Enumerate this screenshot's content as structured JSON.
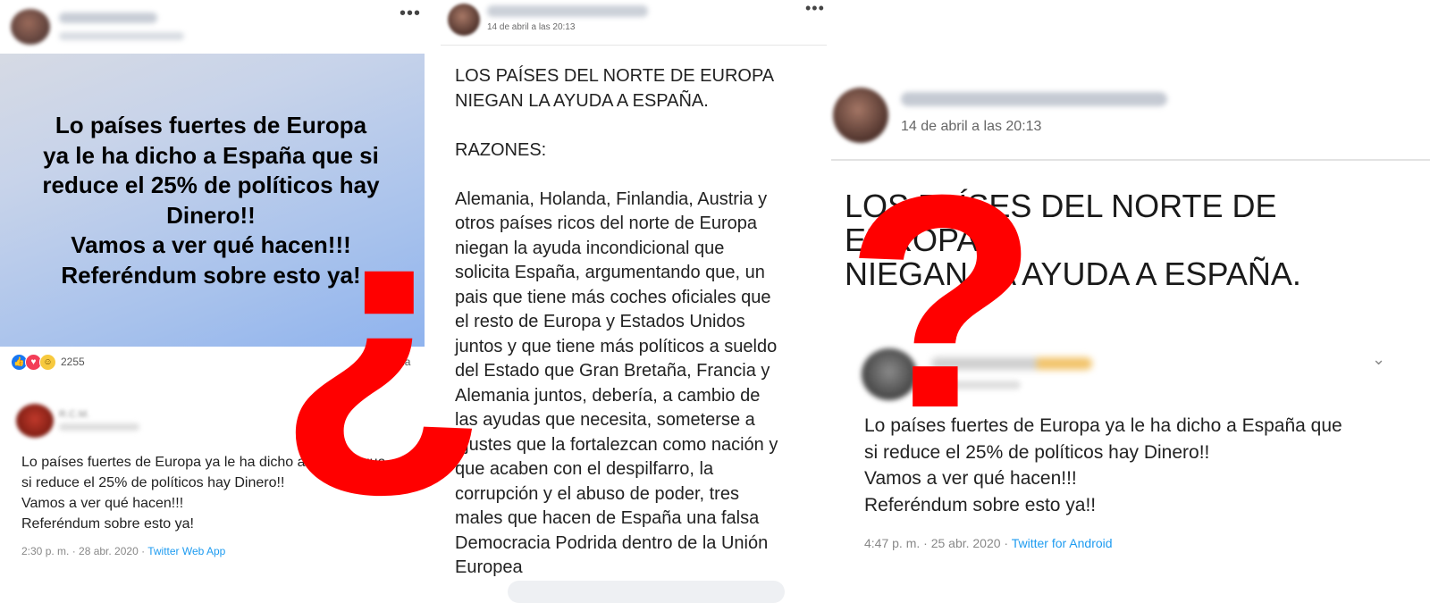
{
  "panel_a": {
    "card_text": "Lo países fuertes de Europa\nya le ha dicho a España que si\nreduce el 25% de políticos hay\nDinero!!\nVamos a ver qué hacen!!!\nReferéndum sobre esto ya!",
    "reaction_count": "2255",
    "shared_label": "compartida",
    "tweet": {
      "name": "R.C.M.",
      "text": "Lo países fuertes de Europa ya le ha dicho a España que\nsi reduce el 25% de políticos hay Dinero!!\nVamos a ver qué hacen!!!\nReferéndum sobre esto ya!",
      "time": "2:30 p. m. · 28 abr. 2020 · ",
      "source": "Twitter Web App"
    }
  },
  "panel_b": {
    "date": "14 de abril a las 20:13",
    "body": "LOS PAÍSES DEL NORTE DE EUROPA\nNIEGAN LA AYUDA A ESPAÑA.\n\nRAZONES:\n\nAlemania, Holanda, Finlandia, Austria y\notros países ricos del norte de Europa\nniegan la ayuda incondicional que\nsolicita España, argumentando que, un\npais que tiene más coches oficiales que\nel resto de Europa y Estados Unidos\njuntos y que tiene más políticos a sueldo\ndel Estado que Gran Bretaña, Francia y\nAlemania juntos, debería, a cambio de\nlas ayudas que necesita, someterse a\najustes que la fortalezcan como nación y\nque acaben con el despilfarro, la\ncorrupción y el abuso de poder, tres\nmales que hacen de España una falsa\nDemocracia Podrida dentro de la Unión\nEuropea"
  },
  "panel_c": {
    "date": "14 de abril a las 20:13",
    "headline": "LOS PAÍSES DEL NORTE DE EUROPA\nNIEGAN LA AYUDA A ESPAÑA.",
    "tweet": {
      "text": "Lo países fuertes de Europa ya le ha dicho a España que\nsi reduce el 25% de políticos hay Dinero!!\nVamos a ver qué hacen!!!\nReferéndum sobre esto ya!!",
      "time": "4:47 p. m. · 25 abr. 2020 · ",
      "source": "Twitter for Android"
    }
  },
  "overlay": {
    "inverted_question": "¿",
    "question": "?",
    "color": "#ff0000"
  },
  "icons": {
    "more": "more-horizontal-icon",
    "chevron": "chevron-down-icon",
    "reactions": [
      "like-icon",
      "love-icon",
      "haha-icon"
    ]
  }
}
